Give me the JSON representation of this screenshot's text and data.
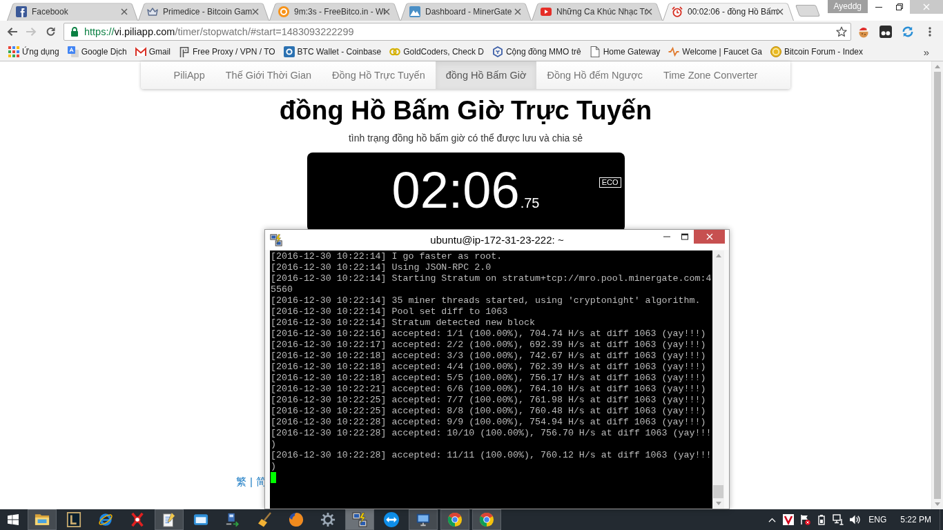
{
  "browser": {
    "tabs": [
      {
        "title": "Facebook",
        "kind": "square",
        "selected": false
      },
      {
        "title": "Primedice - Bitcoin Gam",
        "kind": "crown",
        "selected": false
      },
      {
        "title": "9m:3s - FreeBitco.in - Wi",
        "kind": "coin",
        "selected": false
      },
      {
        "title": "Dashboard - MinerGate",
        "kind": "mountain",
        "selected": false
      },
      {
        "title": "Những Ca Khúc Nhạc Tr",
        "kind": "video",
        "selected": false
      },
      {
        "title": "00:02:06 - đồng Hồ Bấm",
        "kind": "alarm",
        "selected": true
      }
    ],
    "profile": "Ayeddg",
    "nav_buttons": [
      {
        "kind": "back",
        "disabled": false
      },
      {
        "kind": "forward",
        "disabled": true
      },
      {
        "kind": "reload",
        "disabled": false
      }
    ],
    "address": {
      "scheme": "https://",
      "host": "vi.piliapp.com",
      "path": "/timer/stopwatch/#start=1483093222299"
    },
    "bookmarks": [
      {
        "label": "Ứng dụng",
        "kind": "apps"
      },
      {
        "label": "Google Dịch",
        "kind": "translate"
      },
      {
        "label": "Gmail",
        "kind": "mail"
      },
      {
        "label": "Free Proxy / VPN / TO",
        "kind": "bracket"
      },
      {
        "label": "BTC Wallet - Coinbase",
        "kind": "squarering"
      },
      {
        "label": "GoldCoders, Check D",
        "kind": "rings"
      },
      {
        "label": "Cộng đồng MMO trê",
        "kind": "hexagon"
      },
      {
        "label": "Home Gateway",
        "kind": "page"
      },
      {
        "label": "Welcome | Faucet Ga",
        "kind": "zigzag"
      },
      {
        "label": "Bitcoin Forum - Index",
        "kind": "goldcoin"
      }
    ],
    "bookmarks_more": "»"
  },
  "page": {
    "nav": [
      {
        "label": "PiliApp",
        "selected": false
      },
      {
        "label": "Thế Giới Thời Gian",
        "selected": false
      },
      {
        "label": "Đồng Hồ Trực Tuyến",
        "selected": false
      },
      {
        "label": "đồng Hồ Bấm Giờ",
        "selected": true
      },
      {
        "label": "Đồng Hồ đếm Ngược",
        "selected": false
      },
      {
        "label": "Time Zone Converter",
        "selected": false
      }
    ],
    "title": "đồng Hồ Bấm Giờ Trực Tuyến",
    "subtitle": "tình trạng đồng hồ bấm giờ có thể được lưu và chia sẻ",
    "stopwatch": {
      "time": "02:06",
      "fraction": ".75",
      "badge": "ECO"
    },
    "language_links": [
      "繁",
      "简"
    ],
    "language_separator": "|"
  },
  "terminal": {
    "title": "ubuntu@ip-172-31-23-222: ~",
    "lines": [
      "[2016-12-30 10:22:14] I go faster as root.",
      "[2016-12-30 10:22:14] Using JSON-RPC 2.0",
      "[2016-12-30 10:22:14] Starting Stratum on stratum+tcp://mro.pool.minergate.com:4",
      "5560",
      "[2016-12-30 10:22:14] 35 miner threads started, using 'cryptonight' algorithm.",
      "[2016-12-30 10:22:14] Pool set diff to 1063",
      "[2016-12-30 10:22:14] Stratum detected new block",
      "[2016-12-30 10:22:16] accepted: 1/1 (100.00%), 704.74 H/s at diff 1063 (yay!!!)",
      "[2016-12-30 10:22:17] accepted: 2/2 (100.00%), 692.39 H/s at diff 1063 (yay!!!)",
      "[2016-12-30 10:22:18] accepted: 3/3 (100.00%), 742.67 H/s at diff 1063 (yay!!!)",
      "[2016-12-30 10:22:18] accepted: 4/4 (100.00%), 762.39 H/s at diff 1063 (yay!!!)",
      "[2016-12-30 10:22:18] accepted: 5/5 (100.00%), 756.17 H/s at diff 1063 (yay!!!)",
      "[2016-12-30 10:22:21] accepted: 6/6 (100.00%), 764.10 H/s at diff 1063 (yay!!!)",
      "[2016-12-30 10:22:25] accepted: 7/7 (100.00%), 761.98 H/s at diff 1063 (yay!!!)",
      "[2016-12-30 10:22:25] accepted: 8/8 (100.00%), 760.48 H/s at diff 1063 (yay!!!)",
      "[2016-12-30 10:22:28] accepted: 9/9 (100.00%), 754.94 H/s at diff 1063 (yay!!!)",
      "[2016-12-30 10:22:28] accepted: 10/10 (100.00%), 756.70 H/s at diff 1063 (yay!!!",
      ")",
      "[2016-12-30 10:22:28] accepted: 11/11 (100.00%), 760.12 H/s at diff 1063 (yay!!!",
      ")"
    ],
    "cursor": true
  },
  "taskbar": {
    "items": [
      {
        "kind": "folder",
        "open": true,
        "active": false
      },
      {
        "kind": "frame",
        "open": false,
        "active": false
      },
      {
        "kind": "orbit",
        "open": false,
        "active": false
      },
      {
        "kind": "cross",
        "open": false,
        "active": false
      },
      {
        "kind": "notepad",
        "open": true,
        "active": false
      },
      {
        "kind": "window",
        "open": false,
        "active": false
      },
      {
        "kind": "transfer",
        "open": false,
        "active": false
      },
      {
        "kind": "brush",
        "open": false,
        "active": false
      },
      {
        "kind": "globe",
        "open": false,
        "active": false
      },
      {
        "kind": "gear",
        "open": false,
        "active": false
      },
      {
        "kind": "computers",
        "open": true,
        "active": true
      },
      {
        "kind": "arrows",
        "open": false,
        "active": false
      },
      {
        "kind": "monitor",
        "open": true,
        "active": false
      },
      {
        "kind": "pinwheel",
        "open": true,
        "active": false
      },
      {
        "kind": "pinwheel",
        "open": true,
        "active": false
      }
    ],
    "language": "ENG",
    "time": "5:22 PM"
  }
}
